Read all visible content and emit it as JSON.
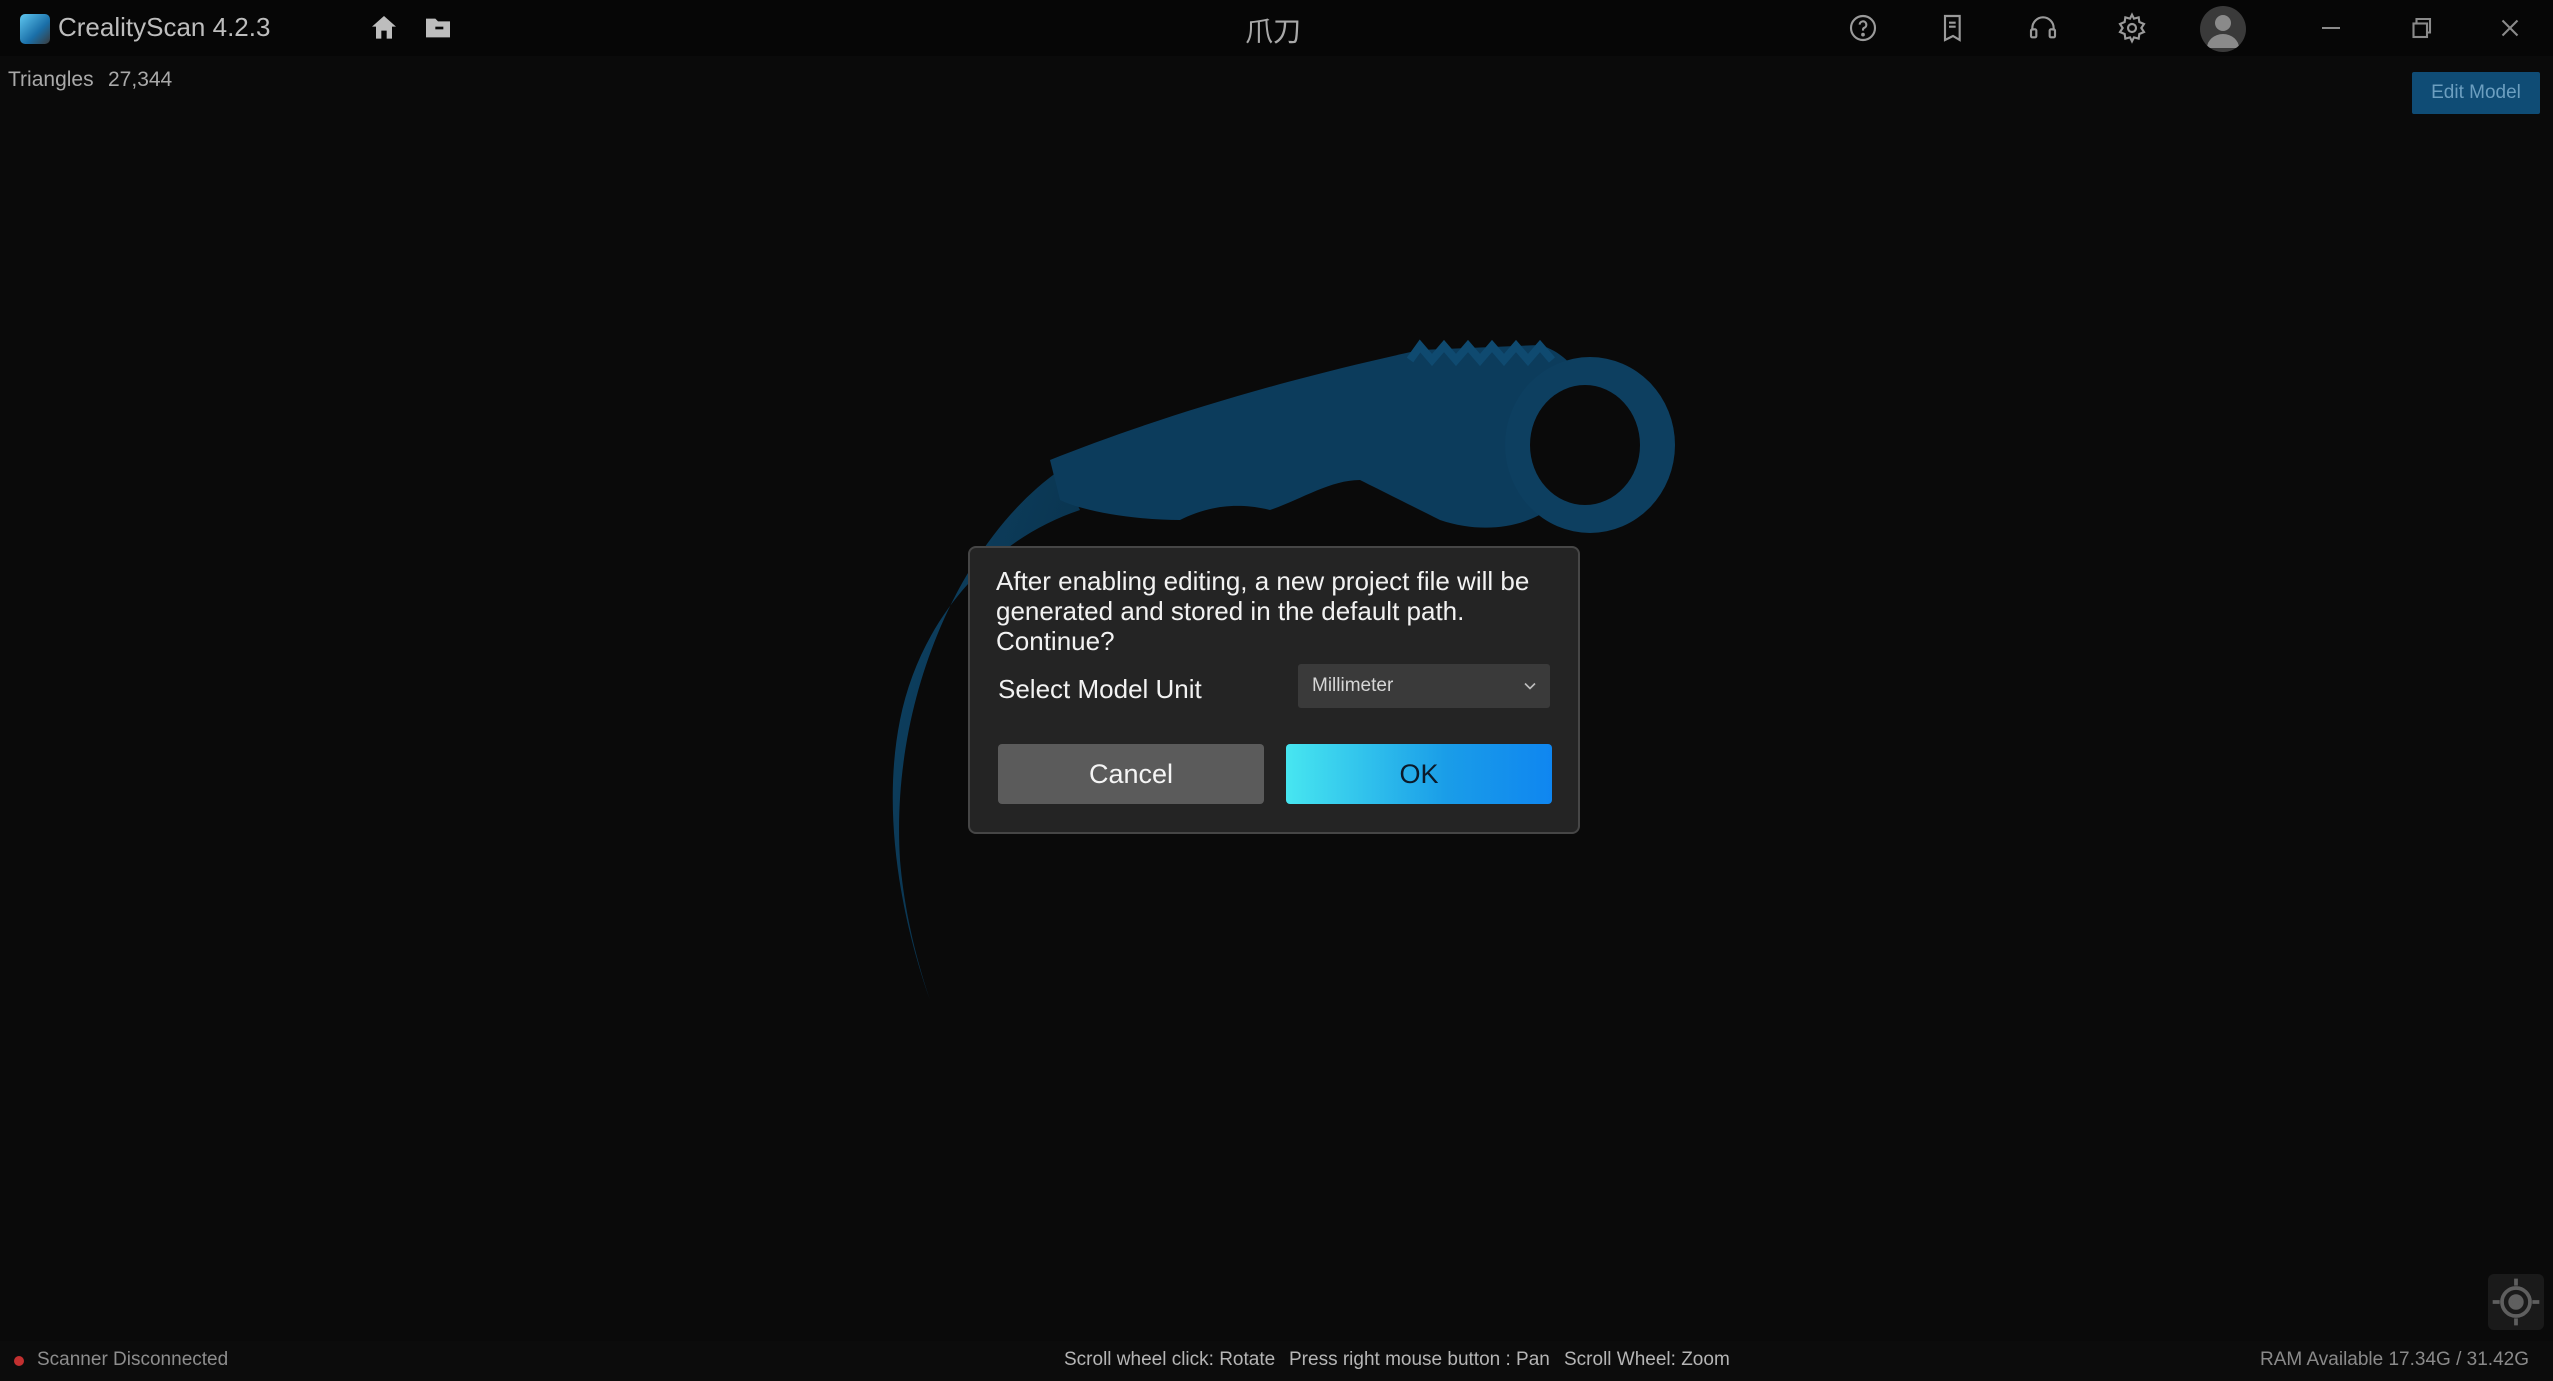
{
  "app": {
    "title": "CrealityScan 4.2.3",
    "project_name": "爪刀"
  },
  "toolbar": {
    "icons": [
      "home-icon",
      "folder-icon",
      "help-icon",
      "notes-icon",
      "headset-icon",
      "gear-icon",
      "avatar"
    ]
  },
  "info": {
    "triangles_label": "Triangles",
    "triangles_value": "27,344"
  },
  "actions": {
    "edit_model_label": "Edit Model"
  },
  "dialog": {
    "message": "After enabling editing, a new project file will be generated and stored in the default path. Continue?",
    "unit_label": "Select Model Unit",
    "unit_selected": "Millimeter",
    "cancel_label": "Cancel",
    "ok_label": "OK"
  },
  "status": {
    "scanner": "Scanner Disconnected",
    "hints": [
      "Scroll wheel click: Rotate",
      "Press right mouse button : Pan",
      "Scroll Wheel: Zoom"
    ],
    "ram": "RAM Available 17.34G / 31.42G"
  },
  "colors": {
    "accent": "#1a9de8",
    "model": "#0d3a57",
    "status_error": "#c23030"
  }
}
